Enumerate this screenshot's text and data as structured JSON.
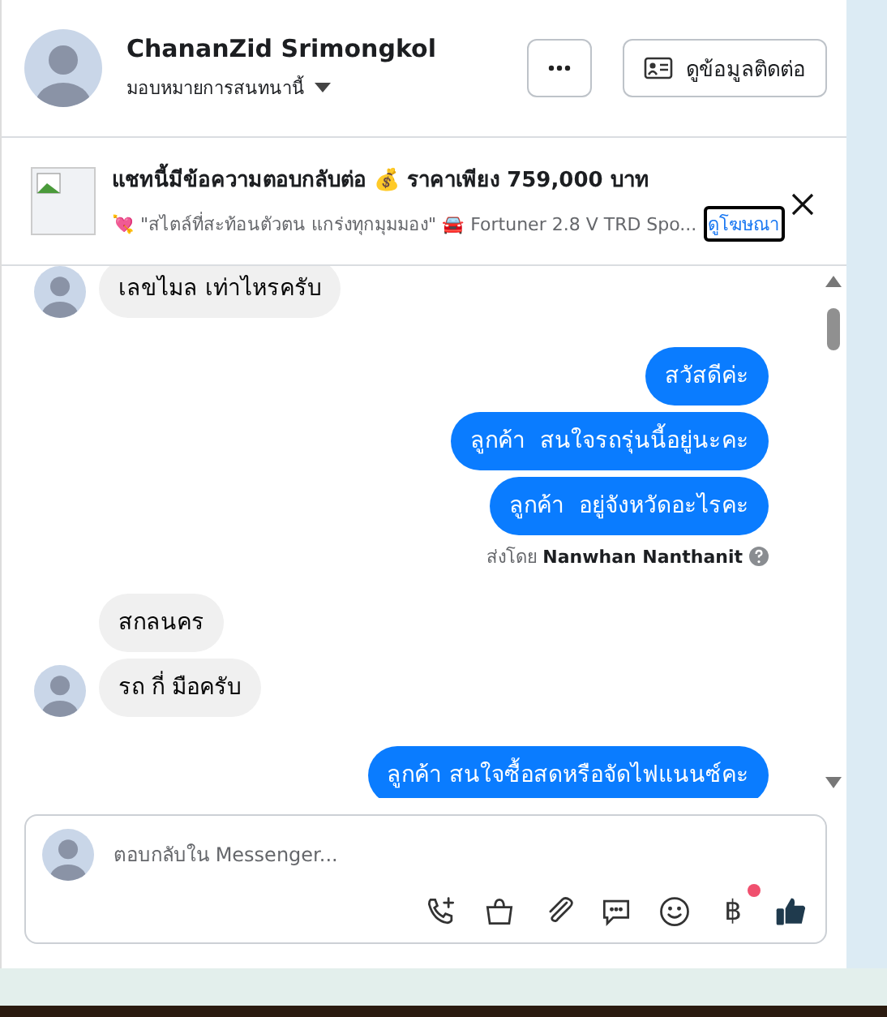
{
  "header": {
    "name": "ChananZid Srimongkol",
    "assign_label": "มอบหมายการสนทนานี้",
    "contact_button": "ดูข้อมูลติดต่อ"
  },
  "ad": {
    "title": "แชทนี้มีข้อความตอบกลับต่อ 💰 ราคาเพียง 759,000 บาท",
    "subtitle": "💘 \"สไตล์ที่สะท้อนตัวตน แกร่งทุกมุมมอง\" 🚘 Fortuner 2.8 V TRD Spo...",
    "link": "ดูโฆษณา"
  },
  "messages": [
    {
      "kind": "incoming",
      "text": "เลขไมล เท่าไหรครับ",
      "avatar": true
    },
    {
      "kind": "outgoing",
      "text": "สวัสดีค่ะ"
    },
    {
      "kind": "outgoing",
      "text": "ลูกค้า  สนใจรถรุ่นนี้อยู่นะคะ"
    },
    {
      "kind": "outgoing",
      "text": "ลูกค้า  อยู่จังหวัดอะไรคะ"
    },
    {
      "kind": "sent_by",
      "prefix": "ส่งโดย",
      "name": "Nanwhan Nanthanit"
    },
    {
      "kind": "incoming",
      "text": "สกลนคร",
      "avatar": false
    },
    {
      "kind": "incoming",
      "text": "รถ กี่ มือครับ",
      "avatar": true
    },
    {
      "kind": "outgoing",
      "text": "ลูกค้า สนใจซื้อสดหรือจัดไฟแนนซ์คะ"
    }
  ],
  "composer": {
    "placeholder": "ตอบกลับใน Messenger...",
    "baht_button": {
      "label": "฿",
      "badge": true
    }
  }
}
